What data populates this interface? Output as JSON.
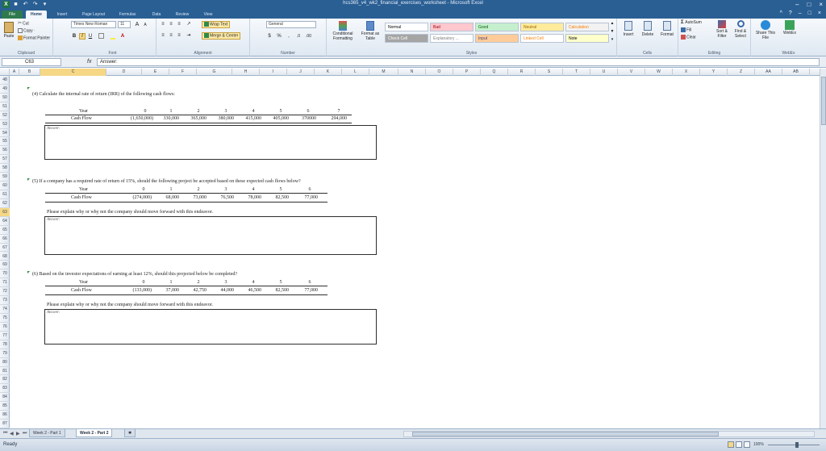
{
  "window": {
    "title": "hcs365_v4_wk2_financial_exercises_worksheet - Microsoft Excel",
    "qat_icons": [
      "excel-icon",
      "save-icon",
      "undo-icon",
      "redo-icon",
      "customize-icon"
    ],
    "controls": [
      "–",
      "□",
      "×"
    ],
    "ribbon_controls": [
      "^",
      "?",
      "–",
      "□",
      "×"
    ]
  },
  "tabs": [
    {
      "label": "File"
    },
    {
      "label": "Home"
    },
    {
      "label": "Insert"
    },
    {
      "label": "Page Layout"
    },
    {
      "label": "Formulas"
    },
    {
      "label": "Data"
    },
    {
      "label": "Review"
    },
    {
      "label": "View"
    }
  ],
  "ribbon": {
    "clipboard": {
      "paste": "Paste",
      "cut": "Cut",
      "copy": "Copy ·",
      "format_painter": "Format Painter",
      "label": "Clipboard"
    },
    "font": {
      "name": "Times New Roman",
      "size": "11",
      "grow": "A",
      "shrink": "A",
      "bold": "B",
      "italic": "I",
      "underline": "U",
      "label": "Font"
    },
    "alignment": {
      "wrap": "Wrap Text",
      "merge": "Merge & Center",
      "label": "Alignment"
    },
    "number": {
      "format": "General",
      "currency": "$",
      "percent": "%",
      "comma": ",",
      "label": "Number"
    },
    "styles": {
      "conditional": "Conditional Formatting",
      "format_table": "Format as Table",
      "label": "Styles",
      "cells": [
        {
          "name": "Normal",
          "bg": "#ffffff",
          "fg": "#000000"
        },
        {
          "name": "Bad",
          "bg": "#ffc7ce",
          "fg": "#9c0006"
        },
        {
          "name": "Good",
          "bg": "#c6efce",
          "fg": "#006100"
        },
        {
          "name": "Neutral",
          "bg": "#ffeb9c",
          "fg": "#9c6500"
        },
        {
          "name": "Calculation",
          "bg": "#f2f2f2",
          "fg": "#fa7d00"
        },
        {
          "name": "Check Cell",
          "bg": "#a5a5a5",
          "fg": "#ffffff"
        },
        {
          "name": "Explanatory ...",
          "bg": "#ffffff",
          "fg": "#7f7f7f"
        },
        {
          "name": "Input",
          "bg": "#ffcc99",
          "fg": "#3f3f76"
        },
        {
          "name": "Linked Cell",
          "bg": "#ffffff",
          "fg": "#fa7d00"
        },
        {
          "name": "Note",
          "bg": "#ffffcc",
          "fg": "#000000"
        }
      ]
    },
    "cells": {
      "insert": "Insert",
      "delete": "Delete",
      "format": "Format",
      "label": "Cells"
    },
    "editing": {
      "autosum": "AutoSum",
      "fill": "Fill",
      "clear": "Clear",
      "sort": "Sort & Filter",
      "find": "Find & Select",
      "label": "Editing"
    },
    "webex": {
      "share": "Share This File",
      "webex": "WebEx",
      "label": "WebEx"
    }
  },
  "formula_bar": {
    "name_box": "C63",
    "fx": "fx",
    "value": "Answer:"
  },
  "columns": [
    "A",
    "B",
    "C",
    "D",
    "E",
    "F",
    "G",
    "H",
    "I",
    "J",
    "K",
    "L",
    "M",
    "N",
    "O",
    "P",
    "Q",
    "R",
    "S",
    "T",
    "U",
    "V",
    "W",
    "X",
    "Y",
    "Z",
    "AA",
    "AB"
  ],
  "rows": [
    "48",
    "49",
    "50",
    "51",
    "52",
    "53",
    "54",
    "55",
    "56",
    "57",
    "58",
    "59",
    "60",
    "61",
    "62",
    "63",
    "64",
    "65",
    "66",
    "67",
    "68",
    "69",
    "70",
    "71",
    "72",
    "73",
    "74",
    "75",
    "76",
    "77",
    "78",
    "79",
    "80",
    "81",
    "82",
    "83",
    "84",
    "85",
    "86",
    "87"
  ],
  "selection": {
    "column": "C",
    "row": "63"
  },
  "q4": {
    "prompt": "(4)  Calculate the internal rate of return (IRR) of the following cash flows:",
    "year_label": "Year",
    "cf_label": "Cash Flow",
    "years": [
      "0",
      "1",
      "2",
      "3",
      "4",
      "5",
      "6",
      "7"
    ],
    "flows": [
      "(1,650,000)",
      "330,000",
      "365,000",
      "380,000",
      "415,000",
      "405,000",
      "370000",
      "294,000"
    ],
    "answer": "Answer:"
  },
  "q5": {
    "prompt": "(5)  If a company has a required rate of return of 15%, should the following project be accepted based on these expected cash flows below?",
    "year_label": "Year",
    "cf_label": "Cash Flow",
    "years": [
      "0",
      "1",
      "2",
      "3",
      "4",
      "5",
      "6"
    ],
    "flows": [
      "(274,000)",
      "68,000",
      "73,000",
      "76,500",
      "78,000",
      "82,500",
      "77,000"
    ],
    "explain": "Please explain why or why not the company should move forward with this endeavor.",
    "answer": "Answer:"
  },
  "q6": {
    "prompt": "(6)  Based on the investor expectations of earning at least 12%, should this projected below be completed?",
    "year_label": "Year",
    "cf_label": "Cash Flow",
    "years": [
      "0",
      "1",
      "2",
      "3",
      "4",
      "5",
      "6"
    ],
    "flows": [
      "(133,000)",
      "37,000",
      "42,750",
      "44,000",
      "46,500",
      "82,500",
      "77,000"
    ],
    "explain": "Please explain why or why not the company should move forward with this endeavor.",
    "answer": "Answer:"
  },
  "sheet_tabs": [
    {
      "label": "Week 2 - Part 1"
    },
    {
      "label": "Week 2 - Part 2"
    }
  ],
  "status": {
    "ready": "Ready",
    "zoom": "100%"
  }
}
